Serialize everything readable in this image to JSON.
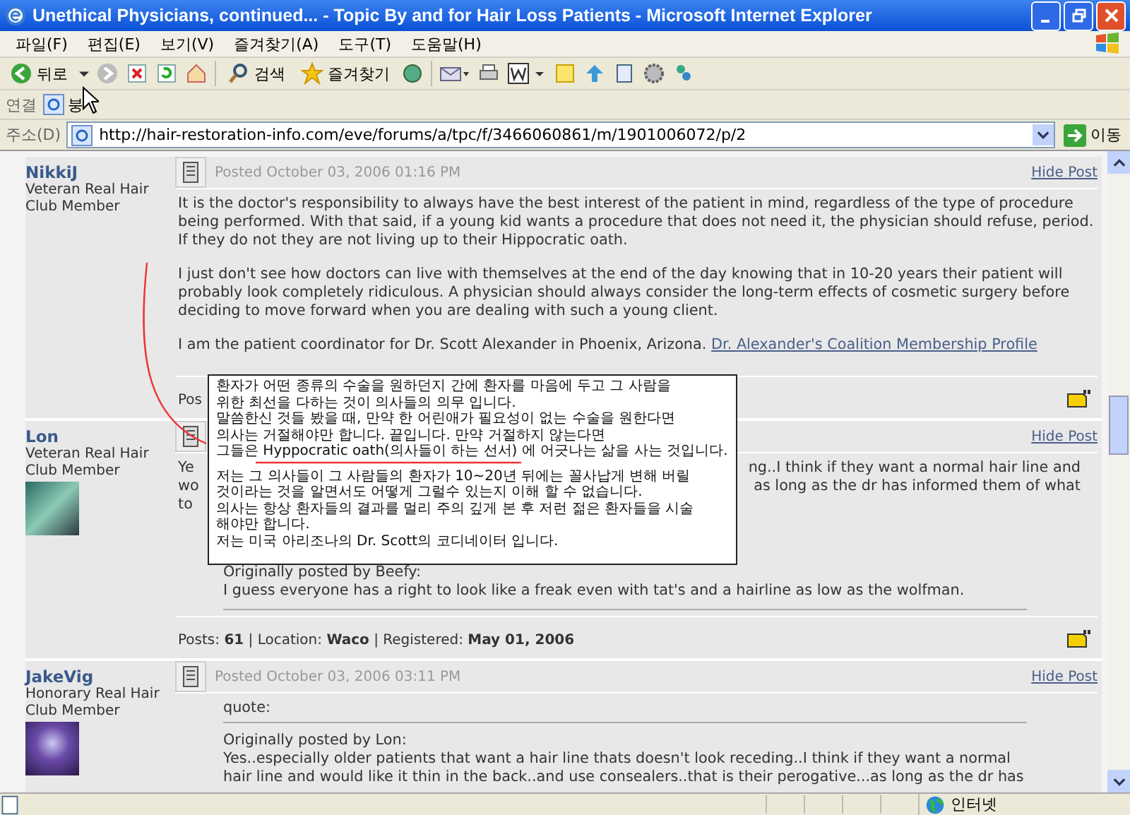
{
  "window": {
    "title": "Unethical Physicians, continued... - Topic By and for Hair Loss Patients - Microsoft Internet Explorer"
  },
  "menu": [
    "파일(F)",
    "편집(E)",
    "보기(V)",
    "즐겨찾기(A)",
    "도구(T)",
    "도움말(H)"
  ],
  "toolbar": {
    "back": "뒤로",
    "search": "검색",
    "favorites": "즐겨찾기"
  },
  "links_bar": {
    "label": "연결",
    "link": "붕"
  },
  "address": {
    "label": "주소(D)",
    "value": "http://hair-restoration-info.com/eve/forums/a/tpc/f/3466060861/m/1901006072/p/2",
    "go": "이동"
  },
  "posts": [
    {
      "author": "NikkiJ",
      "rank": "Veteran Real Hair Club Member",
      "posted": "Posted October 03, 2006 01:16 PM",
      "hide": "Hide Post",
      "paragraphs": [
        "It is the doctor's responsibility to always have the best interest of the patient in mind, regardless of the type of procedure being performed. With that said, if a young kid wants a procedure that does not need it, the physician should refuse, period. If they do not they are not living up to their Hippocratic oath.",
        "I just don't see how doctors can live with themselves at the end of the day knowing that in 10-20 years their patient will probably look completely ridiculous. A physician should always consider the long-term effects of cosmetic surgery before deciding to move forward when you are dealing with such a young client."
      ],
      "signature": "I am the patient coordinator for Dr. Scott Alexander in Phoenix, Arizona.",
      "signature_link": "Dr. Alexander's Coalition Membership Profile",
      "footer": "Pos"
    },
    {
      "author": "Lon",
      "rank": "Veteran Real Hair Club Member",
      "avatar": true,
      "hide": "Hide Post",
      "fragments": [
        {
          "left": "Ye",
          "right": "ng..I think if they want a normal hair line and"
        },
        {
          "left": "wo",
          "right": "as long as the dr has informed them of what"
        },
        {
          "left": "to"
        }
      ],
      "quote": {
        "by": "Originally posted by Beefy:",
        "lines": [
          "I guess everyone has a right to look like a freak even with tat's and a hairline as low as the wolfman."
        ]
      },
      "footer": "Posts: **61** | Location: **Waco** | Registered: **May 01, 2006**"
    },
    {
      "author": "JakeVig",
      "rank": "Honorary Real Hair Club Member",
      "avatar": true,
      "posted": "Posted October 03, 2006 03:11 PM",
      "hide": "Hide Post",
      "quote": {
        "label": "quote:",
        "by": "Originally posted by Lon:",
        "lines": [
          "Yes..especially older patients that want a hair line thats doesn't look receding..I think if they want a normal hair line and would like it thin in the back..and use consealers..that is their perogative...as long as the dr has"
        ]
      }
    }
  ],
  "translation": {
    "paragraphs": [
      [
        "환자가 어떤 종류의 수술을 원하던지 간에 환자를 마음에 두고 그 사람을",
        "위한 최선을 다하는 것이 의사들의 의무 입니다.",
        "말씀한신 것들 봤을 때, 만약 한 어린애가 필요성이 없는 수술을 원한다면",
        "의사는 거절해야만 합니다. 끝입니다. 만약 거절하지 않는다면",
        "그들은 Hyppocratic oath(의사들이 하는 선서) 에 어긋나는 삶을 사는 것입니다."
      ],
      [
        "저는 그 의사들이 그 사람들의 환자가 10~20년 뒤에는 꼴사납게 변해 버릴",
        "것이라는 것을 알면서도 어떻게 그럴수 있는지 이해 할 수 없습니다.",
        "의사는 항상 환자들의 결과를 멀리 주의 깊게 본 후 저런 젊은 환자들을 시술",
        "해야만 합니다.",
        "저는 미국 아리조나의 Dr. Scott의 코디네이터 입니다."
      ]
    ]
  },
  "status_bar": {
    "zone": "인터넷"
  }
}
